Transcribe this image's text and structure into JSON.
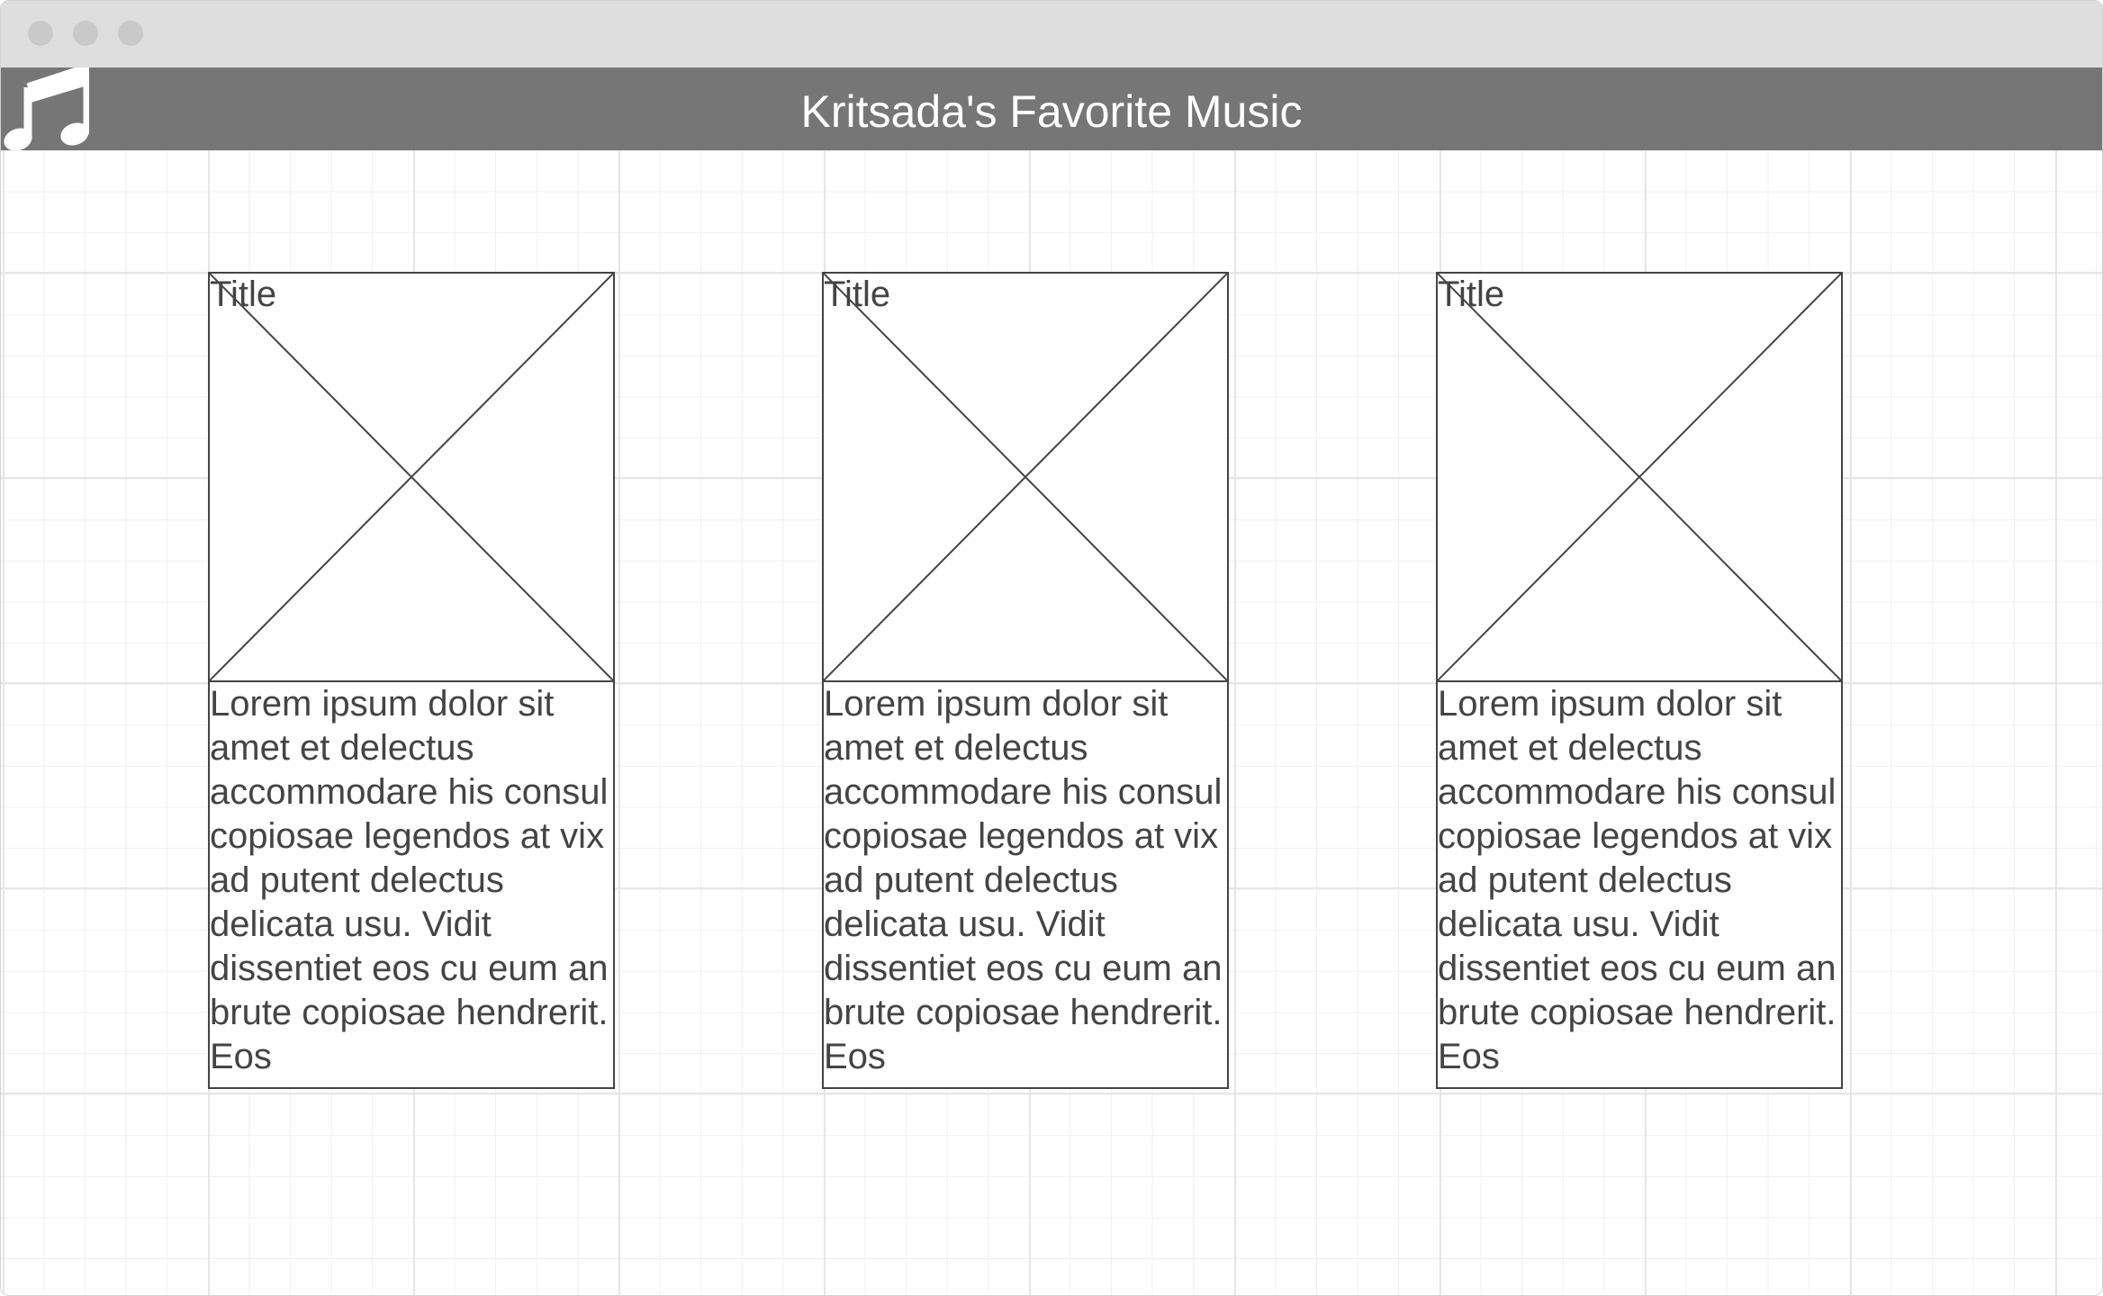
{
  "window": {
    "controls": [
      "close-dot",
      "minimize-dot",
      "zoom-dot"
    ]
  },
  "header": {
    "icon": "music-note-icon",
    "title": "Kritsada's Favorite Music",
    "background": "#767676"
  },
  "cards": [
    {
      "title": "Title",
      "image": "image-placeholder",
      "body": "Lorem ipsum dolor sit amet et delectus accommodare his consul copiosae legendos at vix ad putent delectus delicata usu. Vidit dissentiet eos cu eum an brute copiosae hendrerit. Eos"
    },
    {
      "title": "Title",
      "image": "image-placeholder",
      "body": "Lorem ipsum dolor sit amet et delectus accommodare his consul copiosae legendos at vix ad putent delectus delicata usu. Vidit dissentiet eos cu eum an brute copiosae hendrerit. Eos"
    },
    {
      "title": "Title",
      "image": "image-placeholder",
      "body": "Lorem ipsum dolor sit amet et delectus accommodare his consul copiosae legendos at vix ad putent delectus delicata usu. Vidit dissentiet eos cu eum an brute copiosae hendrerit. Eos"
    }
  ]
}
